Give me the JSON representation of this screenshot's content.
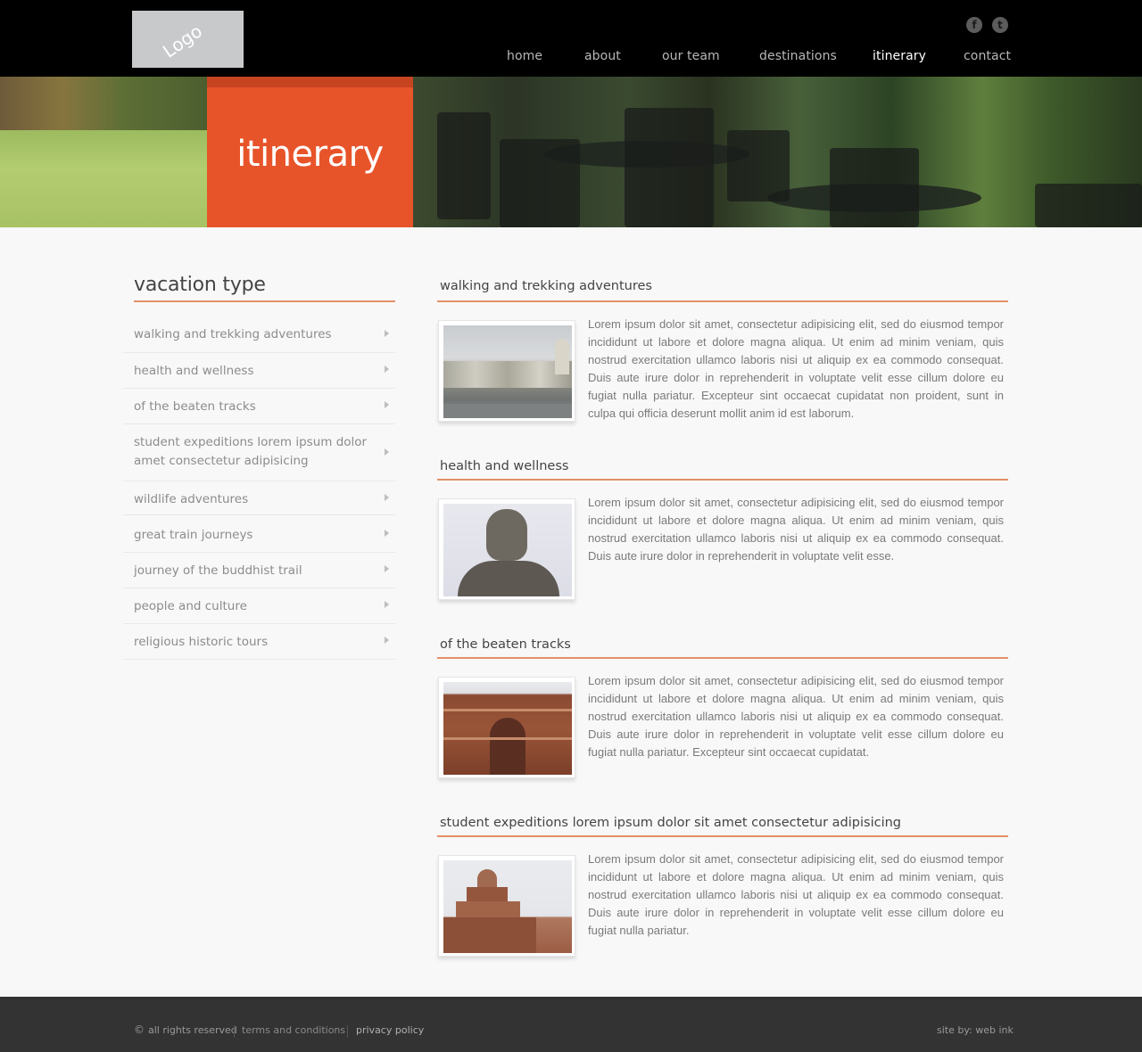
{
  "header": {
    "logo_text": "Logo",
    "social": [
      {
        "name": "facebook",
        "glyph": "f"
      },
      {
        "name": "twitter",
        "glyph": "t"
      }
    ],
    "nav": [
      {
        "label": "home"
      },
      {
        "label": "about"
      },
      {
        "label": "our team"
      },
      {
        "label": "destinations"
      },
      {
        "label": "itinerary",
        "active": true
      },
      {
        "label": "contact"
      }
    ]
  },
  "banner": {
    "title": "itinerary",
    "accent_color": "#e8542a"
  },
  "sidebar": {
    "title": "vacation type",
    "items": [
      {
        "label": "walking and trekking adventures"
      },
      {
        "label": "health and wellness"
      },
      {
        "label": "of the beaten tracks"
      },
      {
        "label": "student expeditions lorem ipsum dolor amet consectetur adipisicing"
      },
      {
        "label": "wildlife adventures"
      },
      {
        "label": "great train journeys"
      },
      {
        "label": "journey of the buddhist trail"
      },
      {
        "label": "people and culture"
      },
      {
        "label": "religious historic tours"
      }
    ]
  },
  "sections": [
    {
      "title": "walking and trekking adventures",
      "image": "riverside-temple-photo",
      "text": "Lorem ipsum dolor sit amet, consectetur adipisicing elit, sed do eiusmod tempor incididunt ut labore et dolore magna aliqua. Ut enim ad minim veniam, quis nostrud exercitation ullamco laboris nisi ut aliquip ex ea commodo consequat. Duis aute irure dolor in reprehenderit in voluptate velit esse cillum dolore eu fugiat nulla pariatur. Excepteur sint occaecat cupidatat non proident, sunt in culpa qui officia deserunt mollit anim id est laborum."
    },
    {
      "title": "health and wellness",
      "image": "buddha-statue-photo",
      "text": "Lorem ipsum dolor sit amet, consectetur adipisicing elit, sed do eiusmod tempor incididunt ut labore et dolore magna aliqua. Ut enim ad minim veniam, quis nostrud exercitation ullamco laboris nisi ut aliquip ex ea commodo consequat. Duis aute irure dolor in reprehenderit in voluptate velit esse."
    },
    {
      "title": "of the beaten tracks",
      "image": "fort-gate-photo",
      "text": "Lorem ipsum dolor sit amet, consectetur adipisicing elit, sed do eiusmod tempor incididunt ut labore et dolore magna aliqua. Ut enim ad minim veniam, quis nostrud exercitation ullamco laboris nisi ut aliquip ex ea commodo consequat. Duis aute irure dolor in reprehenderit in voluptate velit esse cillum dolore eu fugiat nulla pariatur. Excepteur sint occaecat cupidatat."
    },
    {
      "title": "student expeditions lorem ipsum dolor sit amet consectetur adipisicing",
      "image": "palace-pavilion-photo",
      "text": "Lorem ipsum dolor sit amet, consectetur adipisicing elit, sed do eiusmod tempor incididunt ut labore et dolore magna aliqua. Ut enim ad minim veniam, quis nostrud exercitation ullamco laboris nisi ut aliquip ex ea commodo consequat. Duis aute irure dolor in reprehenderit in voluptate velit esse cillum dolore eu fugiat nulla pariatur."
    }
  ],
  "footer": {
    "copyright_symbol": "©",
    "rights": "all rights reserved",
    "terms": "terms and conditions",
    "privacy": "privacy policy",
    "credit": "site by: web ink"
  }
}
